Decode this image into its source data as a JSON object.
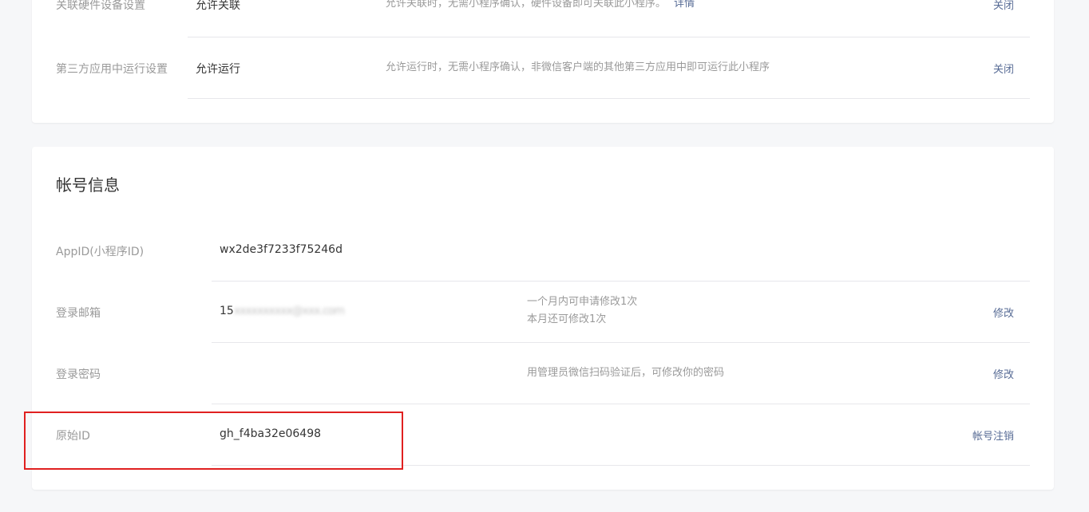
{
  "settings": {
    "rows": [
      {
        "label": "关联硬件设备设置",
        "value": "允许关联",
        "desc": "允许关联时，无需小程序确认，硬件设备即可关联此小程序。",
        "desc_link": "详情",
        "action": "关闭"
      },
      {
        "label": "第三方应用中运行设置",
        "value": "允许运行",
        "desc": "允许运行时，无需小程序确认，非微信客户端的其他第三方应用中即可运行此小程序",
        "action": "关闭"
      }
    ]
  },
  "account": {
    "title": "帐号信息",
    "appid": {
      "label": "AppID(小程序ID)",
      "value": "wx2de3f7233f75246d"
    },
    "email": {
      "label": "登录邮箱",
      "value_prefix": "15",
      "value_masked": "xxxxxxxxxx@xxx.com",
      "desc_line1": "一个月内可申请修改1次",
      "desc_line2": "本月还可修改1次",
      "action": "修改"
    },
    "password": {
      "label": "登录密码",
      "desc": "用管理员微信扫码验证后，可修改你的密码",
      "action": "修改"
    },
    "original_id": {
      "label": "原始ID",
      "value": "gh_f4ba32e06498",
      "action": "帐号注销"
    }
  },
  "highlight": {
    "color": "#e02020"
  }
}
